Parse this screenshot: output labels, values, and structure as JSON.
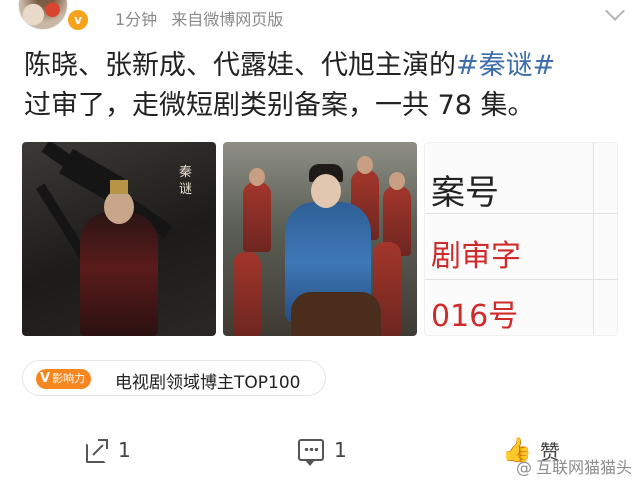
{
  "header": {
    "time": "1分钟",
    "source": "来自微博网页版",
    "verified_badge": "v"
  },
  "post": {
    "text_before": "陈晓、张新成、代露娃、代旭主演的",
    "hashtag": "#秦谜#",
    "text_after": "过审了，走微短剧类别备案，一共 78 集。"
  },
  "images": [
    {
      "title": "秦谜",
      "icon": "poster-image"
    },
    {
      "icon": "still-image"
    },
    {
      "lines": [
        "案号",
        "剧审字",
        "016号"
      ],
      "icon": "document-image"
    }
  ],
  "influence": {
    "badge_v": "V",
    "badge_text": "影响力",
    "label": "电视剧领域博主TOP100"
  },
  "actions": {
    "share_count": "1",
    "comment_count": "1",
    "like_label": "赞"
  },
  "watermark": {
    "at": "@",
    "name": "互联网猫猫头"
  },
  "colors": {
    "hashtag": "#3d6ea9",
    "badge": "#f6861f",
    "verified": "#f7a21b",
    "meta": "#8a8a8a"
  }
}
